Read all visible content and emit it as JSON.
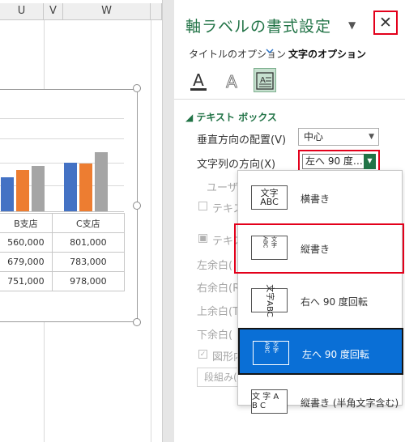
{
  "sheet": {
    "column_headers": [
      "U",
      "V",
      "W"
    ],
    "bar_colors": [
      "#4472c4",
      "#ed7d31",
      "#a5a5a5"
    ],
    "bar_values": [
      {
        "group": "B支店",
        "values": [
          560000,
          679000,
          751000
        ]
      },
      {
        "group": "C支店",
        "values": [
          801000,
          783000,
          978000
        ]
      }
    ],
    "table_header": [
      "B支店",
      "C支店"
    ],
    "table_rows": [
      [
        "560,000",
        "801,000"
      ],
      [
        "679,000",
        "783,000"
      ],
      [
        "751,000",
        "978,000"
      ]
    ]
  },
  "pane": {
    "title": "軸ラベルの書式設定",
    "caret": "▼",
    "close_symbol": "✕",
    "tab_title_options": "タイトルのオプション",
    "tab_text_options": "文字のオプション",
    "section_textbox": "テキスト ボックス",
    "vertical_align_label": "垂直方向の配置(V)",
    "vertical_align_value": "中心",
    "text_direction_label": "文字列の方向(X)",
    "text_direction_value": "左へ 90 度…",
    "custom_label": "ユーザー",
    "text_label_1": "テキス",
    "text_label_2": "テキス",
    "margin_left": "左余白(",
    "margin_right": "右余白(R",
    "margin_top": "上余白(T",
    "margin_bottom": "下余白(",
    "wrap_label": "図形内",
    "columns_button": "段組み("
  },
  "menu": {
    "items": [
      {
        "label": "横書き",
        "icon_text": "文字 ABC"
      },
      {
        "label": "縦書き",
        "icon_text": "文字ABC"
      },
      {
        "label": "右へ 90 度回転",
        "icon_text": "文字 ABC"
      },
      {
        "label": "左へ 90 度回転",
        "icon_text": "文字ABC"
      },
      {
        "label": "縦書き (半角文字含む)",
        "icon_text": "文字 ABC"
      }
    ],
    "selected_index": 3,
    "highlight_color": "#0a6fd6",
    "red_frame_color": "#e3001b"
  }
}
